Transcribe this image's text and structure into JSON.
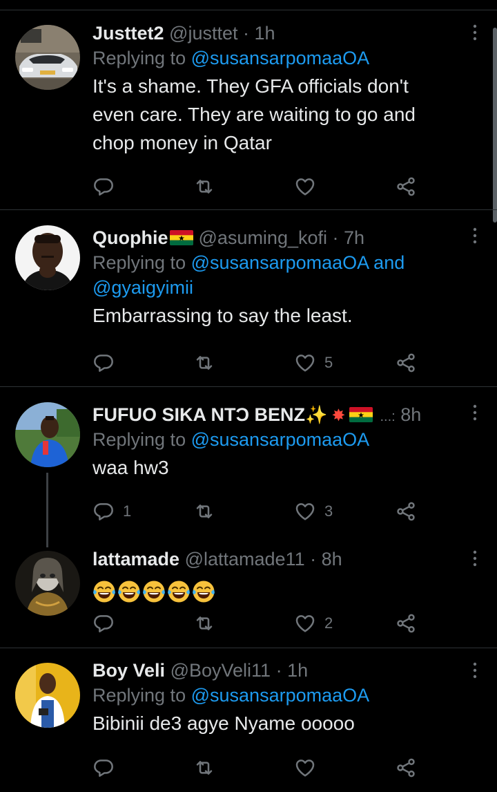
{
  "tweets": [
    {
      "name": "Justtet2",
      "handle": "@justtet",
      "time": "1h",
      "replying_prefix": "Replying to",
      "replying_to": "@susansarpomaaOA",
      "text_lines": [
        "It's a shame. They GFA officials don't",
        "even care. They are waiting to go and",
        "chop money in Qatar"
      ],
      "reply_count": "",
      "like_count": ""
    },
    {
      "name": "Quophie",
      "handle": "@asuming_kofi",
      "time": "7h",
      "replying_prefix": "Replying to",
      "replying_to": "@susansarpomaaOA",
      "replying_and": "and",
      "replying_to2": "@gyaigyimii",
      "text_lines": [
        "Embarrassing to say the least."
      ],
      "like_count": "5"
    },
    {
      "name": "FUFUO SIKA NTƆ BENZ",
      "truncation": "...:",
      "time": "8h",
      "replying_prefix": "Replying to",
      "replying_to": "@susansarpomaaOA",
      "text_lines": [
        "waa hw3"
      ],
      "reply_count": "1",
      "like_count": "3"
    },
    {
      "name": "lattamade",
      "handle": "@lattamade11",
      "time": "8h",
      "emoji_text": "😂😂😂😂😂",
      "like_count": "2"
    },
    {
      "name": "Boy Veli",
      "handle": "@BoyVeli11",
      "time": "1h",
      "replying_prefix": "Replying to",
      "replying_to": "@susansarpomaaOA",
      "text_lines": [
        "Bibinii de3 agye Nyame ooooo"
      ]
    }
  ],
  "icons": {
    "reply": "reply-icon",
    "retweet": "retweet-icon",
    "like": "heart-icon",
    "share": "share-icon",
    "more": "more-vertical-icon"
  },
  "colors": {
    "background": "#000000",
    "text": "#e7e9ea",
    "muted": "#71767b",
    "link": "#1d9bf0",
    "divider": "#2f3336"
  }
}
